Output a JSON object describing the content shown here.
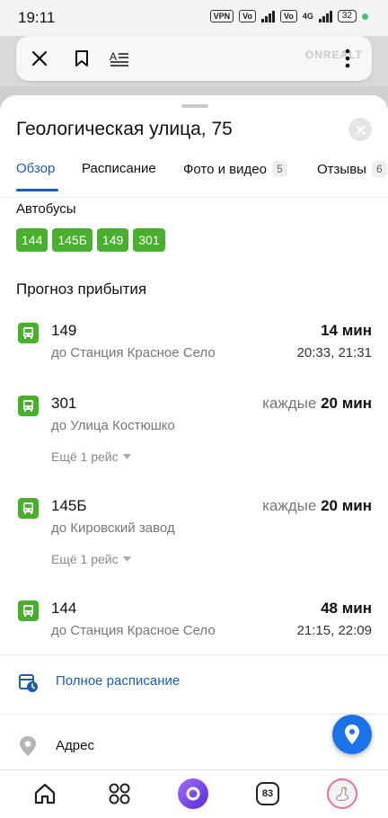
{
  "status_bar": {
    "time": "19:11",
    "vpn": "VPN",
    "net": "4G",
    "battery": "32"
  },
  "toolbar": {
    "watermark": "ONREALT"
  },
  "sheet": {
    "title": "Геологическая улица, 75",
    "tabs": [
      {
        "label": "Обзор",
        "badge": ""
      },
      {
        "label": "Расписание",
        "badge": ""
      },
      {
        "label": "Фото и видео",
        "badge": "5"
      },
      {
        "label": "Отзывы",
        "badge": "6"
      }
    ],
    "buses_label": "Автобусы",
    "bus_chips": [
      "144",
      "145Б",
      "149",
      "301"
    ],
    "forecast_title": "Прогноз прибытия",
    "routes": [
      {
        "number": "149",
        "destination": "до Станция Красное Село",
        "prefix": "",
        "time": "14 мин",
        "times": "20:33, 21:31",
        "more": ""
      },
      {
        "number": "301",
        "destination": "до Улица Костюшко",
        "prefix": "каждые",
        "time": "20 мин",
        "times": "",
        "more": "Ещё 1 рейс"
      },
      {
        "number": "145Б",
        "destination": "до Кировский завод",
        "prefix": "каждые",
        "time": "20 мин",
        "times": "",
        "more": "Ещё 1 рейс"
      },
      {
        "number": "144",
        "destination": "до Станция Красное Село",
        "prefix": "",
        "time": "48 мин",
        "times": "21:15, 22:09",
        "more": ""
      }
    ],
    "schedule_link": "Полное расписание",
    "address_label": "Адрес"
  },
  "bottom_nav": {
    "count": "83"
  },
  "colors": {
    "accent_blue": "#1a5fb4",
    "bus_green": "#48b02c",
    "fab_blue": "#1a73e8"
  }
}
